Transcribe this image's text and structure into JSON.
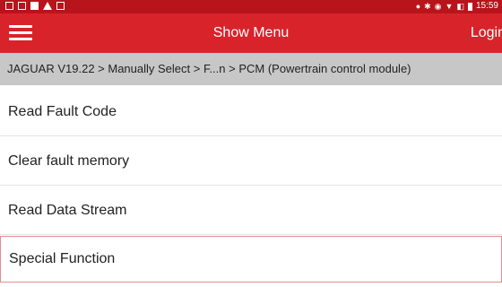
{
  "status_bar": {
    "time": "15:59",
    "background_color": "#b8141b"
  },
  "app_bar": {
    "title": "Show Menu",
    "login_label": "Login",
    "background_color": "#d9232b"
  },
  "breadcrumb": {
    "text": "JAGUAR V19.22 > Manually Select > F...n > PCM (Powertrain control module)"
  },
  "menu": {
    "items": [
      {
        "label": "Read Fault Code"
      },
      {
        "label": "Clear fault memory"
      },
      {
        "label": "Read Data Stream"
      },
      {
        "label": "Special Function",
        "selected": true
      }
    ],
    "selected_border_color": "#e58a8e"
  }
}
